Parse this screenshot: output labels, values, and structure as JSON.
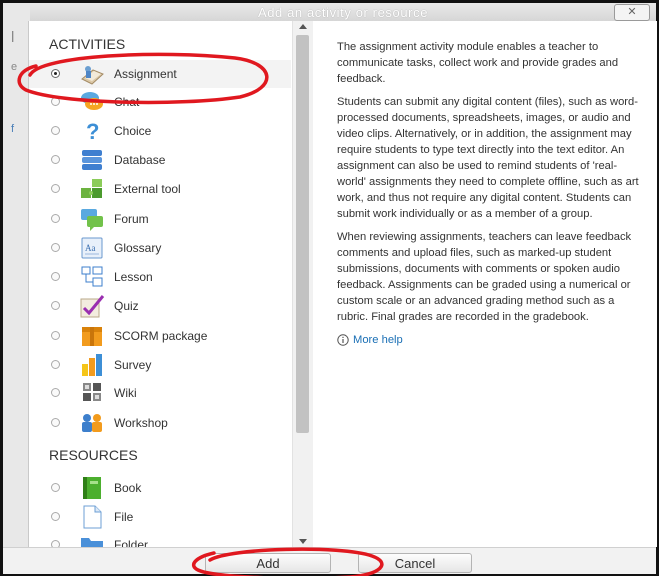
{
  "dialog": {
    "title": "Add an activity or resource"
  },
  "sections": {
    "activities": "ACTIVITIES",
    "resources": "RESOURCES"
  },
  "activities": [
    {
      "label": "Assignment",
      "icon": "assignment-icon",
      "selected": true
    },
    {
      "label": "Chat",
      "icon": "chat-icon"
    },
    {
      "label": "Choice",
      "icon": "choice-icon"
    },
    {
      "label": "Database",
      "icon": "database-icon"
    },
    {
      "label": "External tool",
      "icon": "external-tool-icon"
    },
    {
      "label": "Forum",
      "icon": "forum-icon"
    },
    {
      "label": "Glossary",
      "icon": "glossary-icon"
    },
    {
      "label": "Lesson",
      "icon": "lesson-icon"
    },
    {
      "label": "Quiz",
      "icon": "quiz-icon"
    },
    {
      "label": "SCORM package",
      "icon": "scorm-package-icon"
    },
    {
      "label": "Survey",
      "icon": "survey-icon"
    },
    {
      "label": "Wiki",
      "icon": "wiki-icon"
    },
    {
      "label": "Workshop",
      "icon": "workshop-icon"
    }
  ],
  "resources": [
    {
      "label": "Book",
      "icon": "book-icon"
    },
    {
      "label": "File",
      "icon": "file-icon"
    },
    {
      "label": "Folder",
      "icon": "folder-icon"
    }
  ],
  "description": {
    "paragraphs": [
      "The assignment activity module enables a teacher to communicate tasks, collect work and provide grades and feedback.",
      "Students can submit any digital content (files), such as word-processed documents, spreadsheets, images, or audio and video clips. Alternatively, or in addition, the assignment may require students to type text directly into the text editor. An assignment can also be used to remind students of 'real-world' assignments they need to complete offline, such as art work, and thus not require any digital content. Students can submit work individually or as a member of a group.",
      "When reviewing assignments, teachers can leave feedback comments and upload files, such as marked-up student submissions, documents with comments or spoken audio feedback. Assignments can be graded using a numerical or custom scale or an advanced grading method such as a rubric. Final grades are recorded in the gradebook."
    ],
    "more_help": "More help"
  },
  "buttons": {
    "add": "Add",
    "cancel": "Cancel"
  },
  "colors": {
    "annotation": "#e0181f",
    "link": "#1a6fb5"
  }
}
